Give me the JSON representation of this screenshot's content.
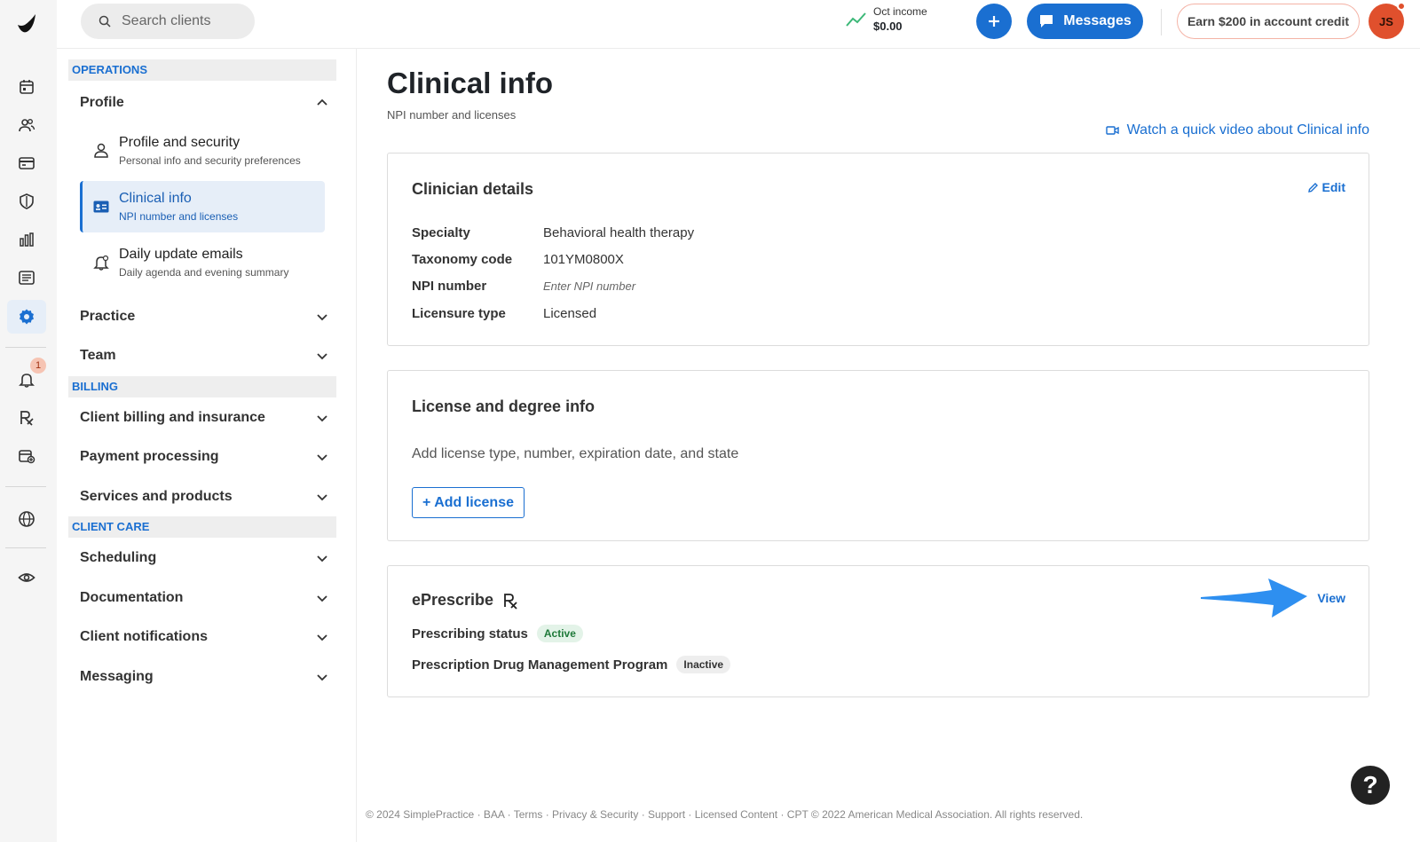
{
  "topbar": {
    "search_placeholder": "Search clients",
    "income_label": "Oct income",
    "income_value": "$0.00",
    "messages_label": "Messages",
    "credit_label": "Earn $200 in account credit",
    "avatar_initials": "JS"
  },
  "rail": {
    "notification_count": "1"
  },
  "nav": {
    "sections": {
      "operations": "OPERATIONS",
      "billing": "BILLING",
      "client_care": "CLIENT CARE"
    },
    "profile": {
      "label": "Profile",
      "items": [
        {
          "title": "Profile and security",
          "desc": "Personal info and security preferences"
        },
        {
          "title": "Clinical info",
          "desc": "NPI number and licenses"
        },
        {
          "title": "Daily update emails",
          "desc": "Daily agenda and evening summary"
        }
      ]
    },
    "groups": {
      "practice": "Practice",
      "team": "Team",
      "client_billing": "Client billing and insurance",
      "payment_processing": "Payment processing",
      "services_products": "Services and products",
      "scheduling": "Scheduling",
      "documentation": "Documentation",
      "client_notifications": "Client notifications",
      "messaging": "Messaging"
    }
  },
  "main": {
    "title": "Clinical info",
    "subtitle": "NPI number and licenses",
    "video_link": "Watch a quick video about Clinical info",
    "clinician": {
      "title": "Clinician details",
      "edit_label": "Edit",
      "rows": [
        {
          "label": "Specialty",
          "value": "Behavioral health therapy"
        },
        {
          "label": "Taxonomy code",
          "value": "101YM0800X"
        },
        {
          "label": "NPI number",
          "value": "Enter NPI number"
        },
        {
          "label": "Licensure type",
          "value": "Licensed"
        }
      ]
    },
    "license": {
      "title": "License and degree info",
      "description": "Add license type, number, expiration date, and state",
      "add_button": "+ Add license"
    },
    "eprescribe": {
      "title": "ePrescribe",
      "view_label": "View",
      "prescribing_label": "Prescribing status",
      "prescribing_status": "Active",
      "pdmp_label": "Prescription Drug Management Program",
      "pdmp_status": "Inactive"
    },
    "footer": "© 2024 SimplePractice · BAA · Terms · Privacy & Security · Support · Licensed Content · CPT © 2022 American Medical Association. All rights reserved.",
    "help_label": "?"
  },
  "colors": {
    "accent": "#1a6fd1",
    "active_bg": "#e6eef8",
    "avatar": "#e0502d",
    "badge_active_bg": "#e3f3e8",
    "arrow": "#2e8ff0"
  }
}
